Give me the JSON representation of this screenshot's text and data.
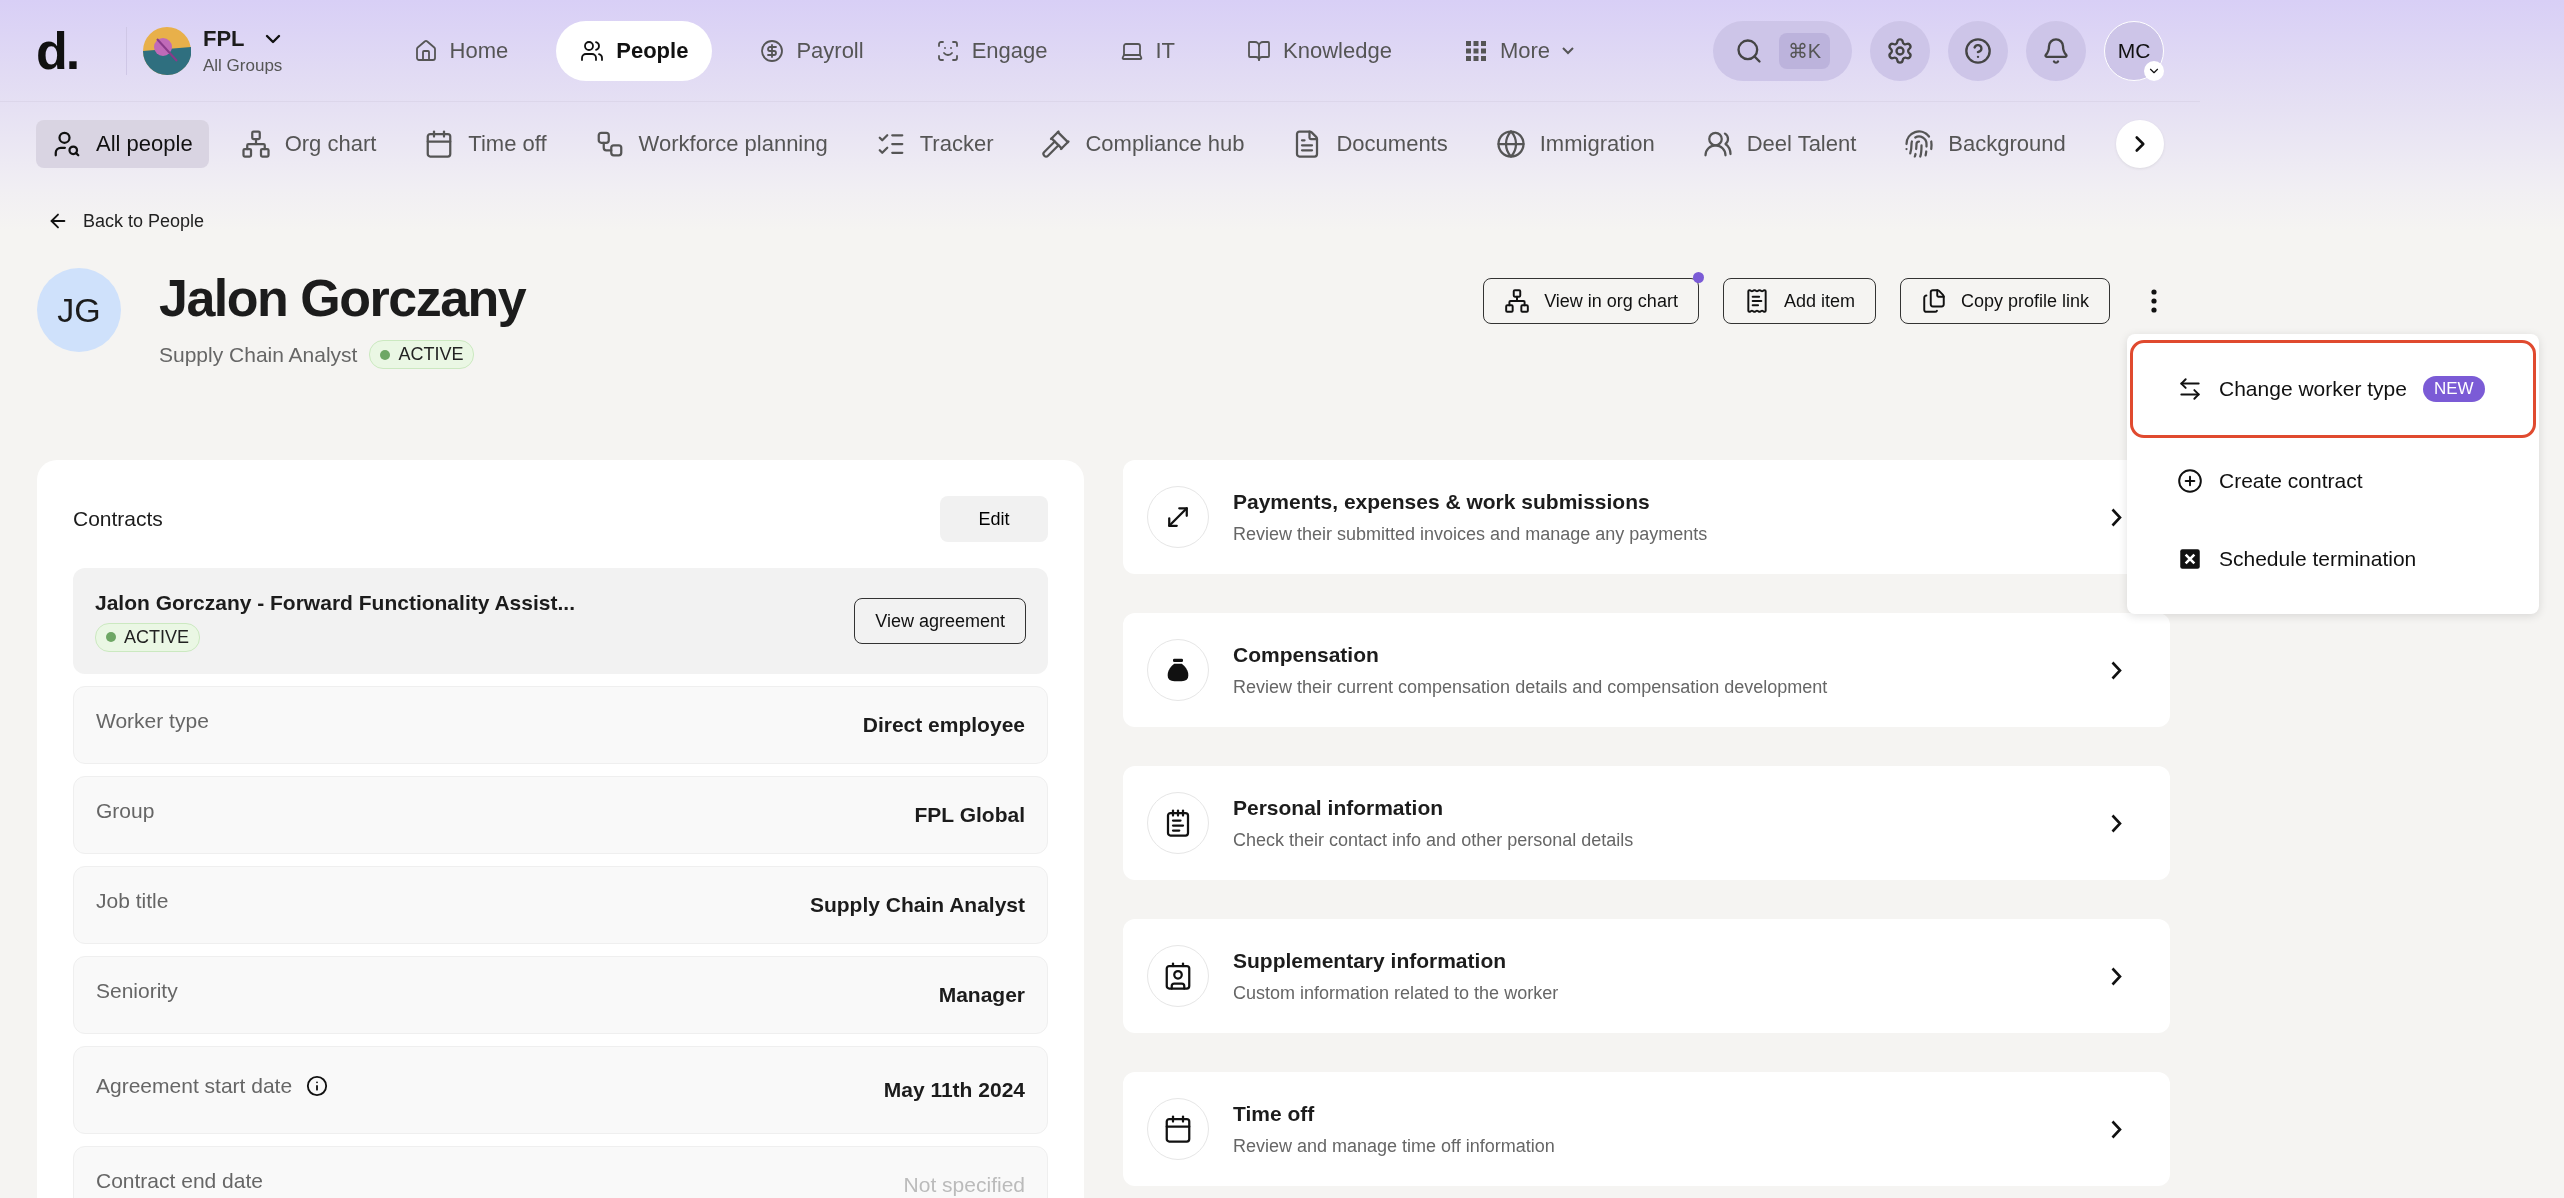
{
  "top_nav": {
    "logo": "d.",
    "org": {
      "name": "FPL",
      "subtitle": "All Groups"
    },
    "items": [
      {
        "label": "Home",
        "selected": false
      },
      {
        "label": "People",
        "selected": true
      },
      {
        "label": "Payroll",
        "selected": false
      },
      {
        "label": "Engage",
        "selected": false
      },
      {
        "label": "IT",
        "selected": false
      },
      {
        "label": "Knowledge",
        "selected": false
      },
      {
        "label": "More",
        "selected": false,
        "dropdown": true
      }
    ],
    "search_shortcut": "⌘K",
    "user_initials": "MC"
  },
  "sub_nav": {
    "items": [
      {
        "label": "All people",
        "selected": true
      },
      {
        "label": "Org chart",
        "selected": false
      },
      {
        "label": "Time off",
        "selected": false
      },
      {
        "label": "Workforce planning",
        "selected": false
      },
      {
        "label": "Tracker",
        "selected": false
      },
      {
        "label": "Compliance hub",
        "selected": false
      },
      {
        "label": "Documents",
        "selected": false
      },
      {
        "label": "Immigration",
        "selected": false
      },
      {
        "label": "Deel Talent",
        "selected": false
      },
      {
        "label": "Background",
        "selected": false
      }
    ]
  },
  "back_link": "Back to People",
  "profile": {
    "initials": "JG",
    "name": "Jalon Gorczany",
    "job_title": "Supply Chain Analyst",
    "status": "ACTIVE"
  },
  "actions": [
    {
      "label": "View in org chart",
      "notification_dot": true
    },
    {
      "label": "Add item",
      "notification_dot": false
    },
    {
      "label": "Copy profile link",
      "notification_dot": false
    }
  ],
  "action_menu": {
    "items": [
      {
        "label": "Change worker type",
        "badge": "NEW",
        "highlighted": true
      },
      {
        "label": "Create contract",
        "highlighted": false
      },
      {
        "label": "Schedule termination",
        "highlighted": false
      }
    ]
  },
  "contracts": {
    "title": "Contracts",
    "edit_label": "Edit",
    "contract": {
      "title": "Jalon Gorczany - Forward Functionality Assist...",
      "status": "ACTIVE",
      "button": "View agreement"
    },
    "fields": [
      {
        "label": "Worker type",
        "value": "Direct employee",
        "info": false,
        "muted": false
      },
      {
        "label": "Group",
        "value": "FPL Global",
        "info": false,
        "muted": false
      },
      {
        "label": "Job title",
        "value": "Supply Chain Analyst",
        "info": false,
        "muted": false
      },
      {
        "label": "Seniority",
        "value": "Manager",
        "info": false,
        "muted": false
      },
      {
        "label": "Agreement start date",
        "value": "May 11th 2024",
        "info": true,
        "muted": false
      },
      {
        "label": "Contract end date",
        "value": "Not specified",
        "info": false,
        "muted": true
      }
    ]
  },
  "sections": [
    {
      "title": "Payments, expenses & work submissions",
      "description": "Review their submitted invoices and manage any payments"
    },
    {
      "title": "Compensation",
      "description": "Review their current compensation details and compensation development"
    },
    {
      "title": "Personal information",
      "description": "Check their contact info and other personal details"
    },
    {
      "title": "Supplementary information",
      "description": "Custom information related to the worker"
    },
    {
      "title": "Time off",
      "description": "Review and manage time off information"
    }
  ]
}
